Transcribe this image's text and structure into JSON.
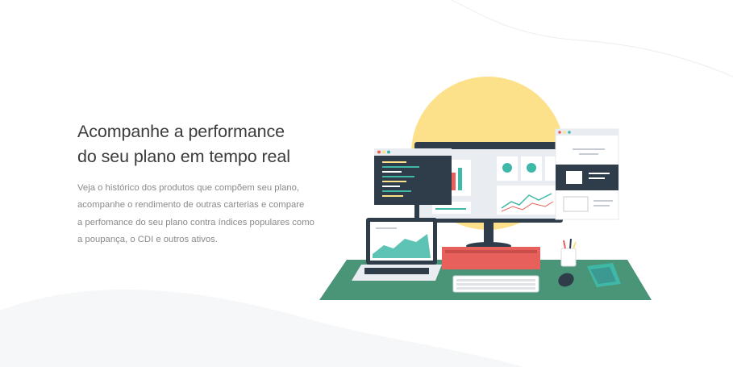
{
  "hero": {
    "headline_lines": [
      "Acompanhe a performance",
      "do seu plano em tempo real"
    ],
    "body_lines": [
      "Veja o histórico dos produtos que compõem seu plano,",
      "acompanhe o rendimento de outras carterias e compare",
      "a perfomance do seu plano contra índices populares como",
      "a poupança, o CDI e outros ativos."
    ]
  },
  "illustration": {
    "subject": "desk-workstation",
    "colors": {
      "sun": "#fde08a",
      "desk": "#4a9478",
      "monitor_frame": "#2f3d4a",
      "red_box": "#e8605c",
      "teal_accent": "#3fb8a8"
    }
  }
}
